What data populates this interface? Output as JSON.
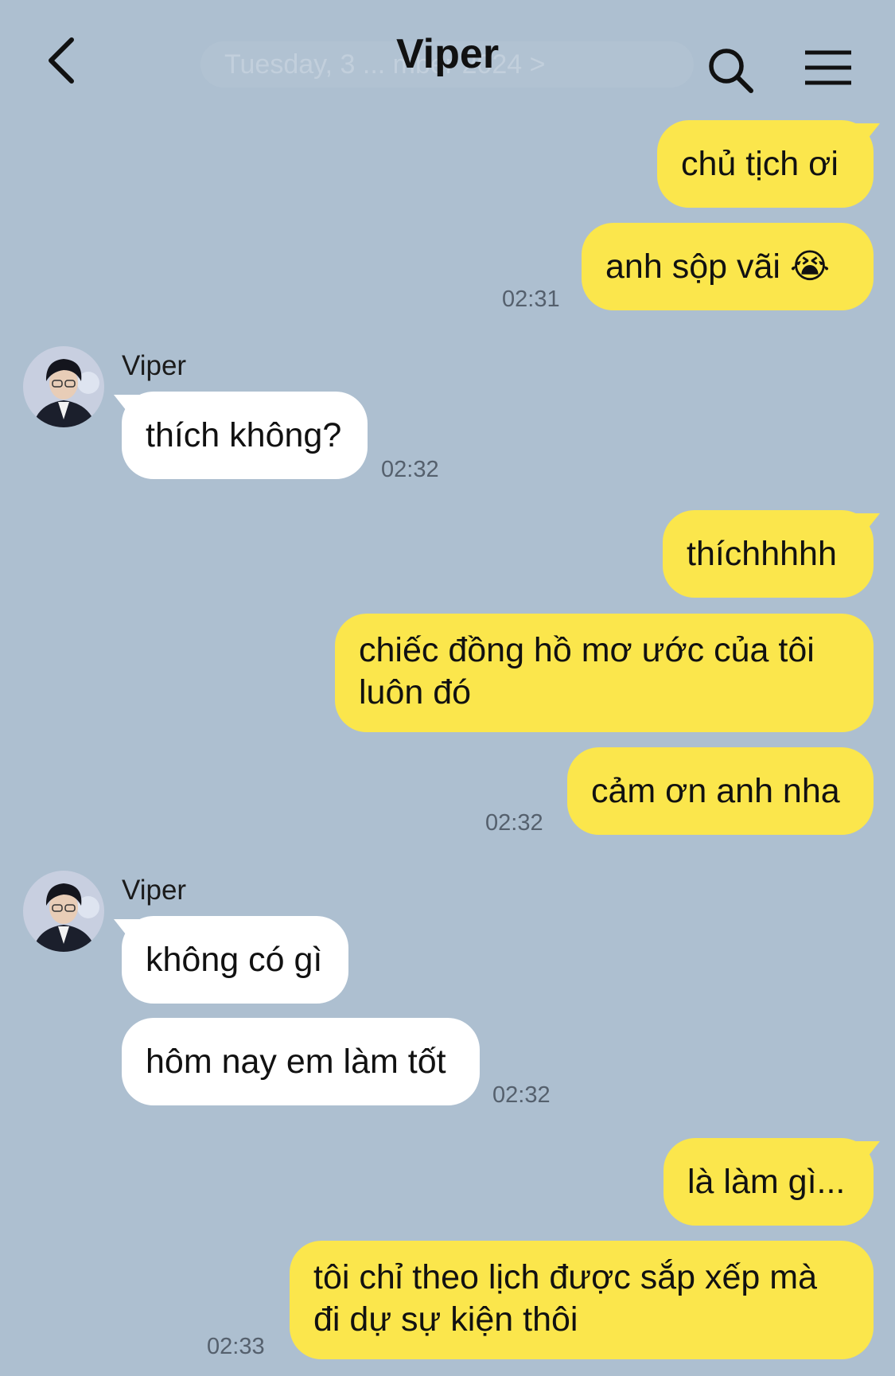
{
  "header": {
    "title": "Viper",
    "ghost_date": "Tuesday, 3 ... mber 2024 >"
  },
  "icons": {
    "back": "chevron-left-icon",
    "search": "search-icon",
    "menu": "hamburger-menu-icon"
  },
  "colors": {
    "background": "#adbfd0",
    "my_bubble": "#fbe64c",
    "their_bubble": "#ffffff"
  },
  "messages": [
    {
      "from": "me",
      "text": "chủ tịch ơi"
    },
    {
      "from": "me",
      "text": "anh sộp vãi 😭",
      "time": "02:31"
    },
    {
      "from": "them",
      "sender": "Viper",
      "text": "thích không?",
      "time": "02:32"
    },
    {
      "from": "me",
      "text": "thíchhhhh"
    },
    {
      "from": "me",
      "text": "chiếc đồng hồ mơ ước của tôi\nluôn đó"
    },
    {
      "from": "me",
      "text": "cảm ơn anh nha",
      "time": "02:32"
    },
    {
      "from": "them",
      "sender": "Viper",
      "text": "không có gì"
    },
    {
      "from": "them",
      "text": "hôm nay em làm tốt",
      "time": "02:32"
    },
    {
      "from": "me",
      "text": "là làm gì..."
    },
    {
      "from": "me",
      "text": "tôi chỉ theo lịch được sắp xếp mà\nđi dự sự kiện thôi",
      "time": "02:33"
    }
  ]
}
